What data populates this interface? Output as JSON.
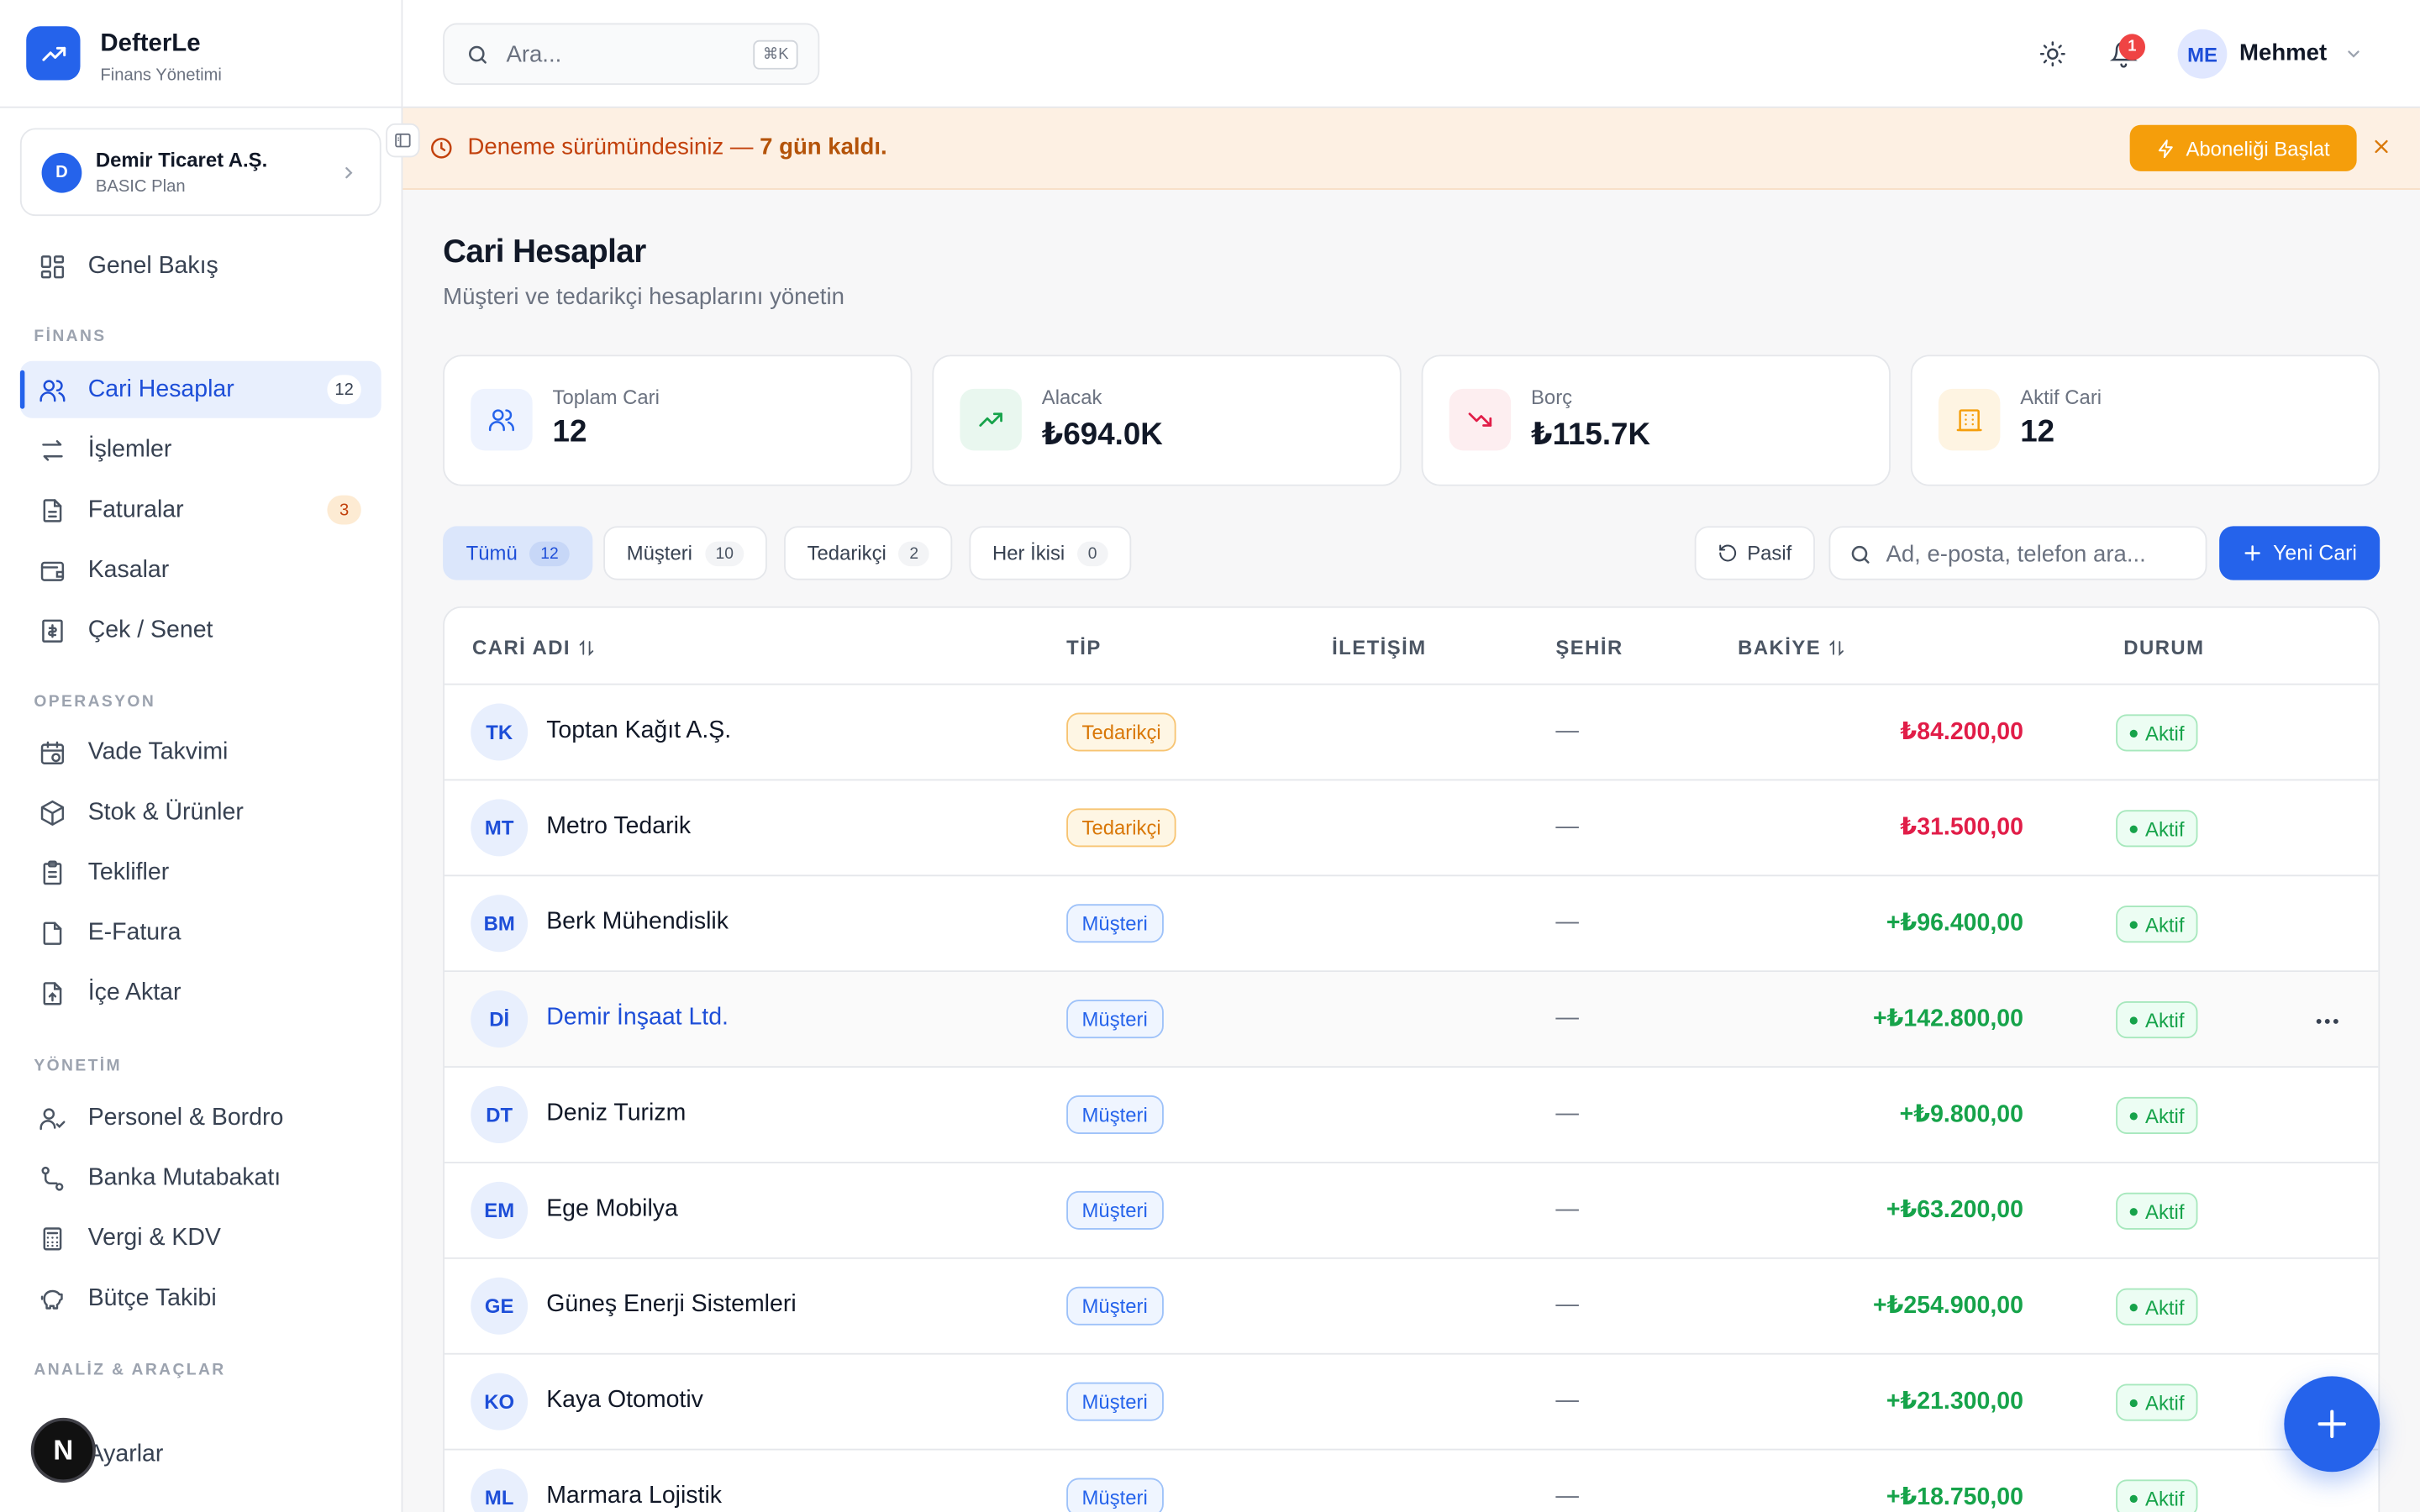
{
  "brand": {
    "name": "DefterLe",
    "subtitle": "Finans Yönetimi"
  },
  "company": {
    "initial": "D",
    "name": "Demir Ticaret A.Ş.",
    "plan": "BASIC Plan"
  },
  "sidebar": {
    "overview": "Genel Bakış",
    "sections": {
      "finance": "FİNANS",
      "operations": "OPERASYON",
      "management": "YÖNETİM",
      "analysis": "ANALİZ & ARAÇLAR"
    },
    "finance_items": [
      {
        "label": "Cari Hesaplar",
        "badge": "12"
      },
      {
        "label": "İşlemler"
      },
      {
        "label": "Faturalar",
        "badge": "3"
      },
      {
        "label": "Kasalar"
      },
      {
        "label": "Çek / Senet"
      }
    ],
    "operations_items": [
      {
        "label": "Vade Takvimi"
      },
      {
        "label": "Stok & Ürünler"
      },
      {
        "label": "Teklifler"
      },
      {
        "label": "E-Fatura"
      },
      {
        "label": "İçe Aktar"
      }
    ],
    "management_items": [
      {
        "label": "Personel & Bordro"
      },
      {
        "label": "Banka Mutabakatı"
      },
      {
        "label": "Vergi & KDV"
      },
      {
        "label": "Bütçe Takibi"
      }
    ],
    "settings": "Ayarlar",
    "next_badge": "N"
  },
  "topbar": {
    "search_placeholder": "Ara...",
    "search_shortcut": "⌘K",
    "notification_count": "1",
    "user_initials": "ME",
    "user_name": "Mehmet"
  },
  "banner": {
    "text": "Deneme sürümündesiniz —",
    "highlight": "7 gün kaldı.",
    "button": "Aboneliği Başlat"
  },
  "page": {
    "title": "Cari Hesaplar",
    "subtitle": "Müşteri ve tedarikçi hesaplarını yönetin"
  },
  "stats": [
    {
      "label": "Toplam Cari",
      "value": "12",
      "color": "#2563eb"
    },
    {
      "label": "Alacak",
      "value": "₺694.0K",
      "color": "#16a34a"
    },
    {
      "label": "Borç",
      "value": "₺115.7K",
      "color": "#e11d48"
    },
    {
      "label": "Aktif Cari",
      "value": "12",
      "color": "#f59e0b"
    }
  ],
  "filters": [
    {
      "label": "Tümü",
      "count": "12"
    },
    {
      "label": "Müşteri",
      "count": "10"
    },
    {
      "label": "Tedarikçi",
      "count": "2"
    },
    {
      "label": "Her İkisi",
      "count": "0"
    }
  ],
  "toolbar": {
    "passive": "Pasif",
    "search_placeholder": "Ad, e-posta, telefon ara...",
    "new_button": "Yeni Cari"
  },
  "table": {
    "columns": [
      "CARİ ADI",
      "TİP",
      "İLETİŞİM",
      "ŞEHİR",
      "BAKİYE",
      "DURUM"
    ],
    "rows": [
      {
        "initials": "TK",
        "name": "Toptan Kağıt A.Ş.",
        "type": "Tedarikçi",
        "city": "—",
        "balance": "₺84.200,00",
        "status": "Aktif"
      },
      {
        "initials": "MT",
        "name": "Metro Tedarik",
        "type": "Tedarikçi",
        "city": "—",
        "balance": "₺31.500,00",
        "status": "Aktif"
      },
      {
        "initials": "BM",
        "name": "Berk Mühendislik",
        "type": "Müşteri",
        "city": "—",
        "balance": "+₺96.400,00",
        "status": "Aktif"
      },
      {
        "initials": "Dİ",
        "name": "Demir İnşaat Ltd.",
        "type": "Müşteri",
        "city": "—",
        "balance": "+₺142.800,00",
        "status": "Aktif"
      },
      {
        "initials": "DT",
        "name": "Deniz Turizm",
        "type": "Müşteri",
        "city": "—",
        "balance": "+₺9.800,00",
        "status": "Aktif"
      },
      {
        "initials": "EM",
        "name": "Ege Mobilya",
        "type": "Müşteri",
        "city": "—",
        "balance": "+₺63.200,00",
        "status": "Aktif"
      },
      {
        "initials": "GE",
        "name": "Güneş Enerji Sistemleri",
        "type": "Müşteri",
        "city": "—",
        "balance": "+₺254.900,00",
        "status": "Aktif"
      },
      {
        "initials": "KO",
        "name": "Kaya Otomotiv",
        "type": "Müşteri",
        "city": "—",
        "balance": "+₺21.300,00",
        "status": "Aktif"
      },
      {
        "initials": "ML",
        "name": "Marmara Lojistik",
        "type": "Müşteri",
        "city": "—",
        "balance": "+₺18.750,00",
        "status": "Aktif"
      }
    ]
  }
}
